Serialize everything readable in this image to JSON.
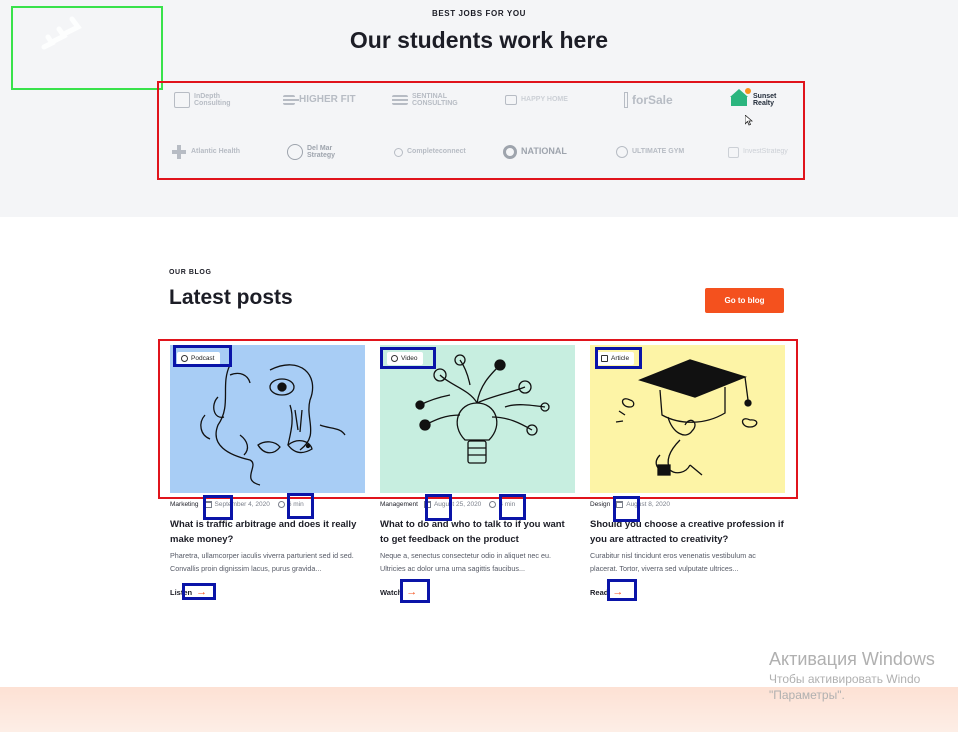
{
  "partners": {
    "eyebrow": "BEST JOBS FOR YOU",
    "title": "Our students work here",
    "logos": [
      {
        "name": "InDepth Consulting",
        "icon": "square-frame-icon"
      },
      {
        "name": "HIGHER FIT",
        "icon": "lines-icon"
      },
      {
        "name": "SENTINAL CONSULTING",
        "icon": "lines-icon"
      },
      {
        "name": "HAPPY HOME",
        "icon": "house-icon"
      },
      {
        "name": "forSale",
        "icon": "sign-icon"
      },
      {
        "name": "Sunset Realty",
        "icon": "house-sun-icon"
      },
      {
        "name": "Atlantic Health",
        "icon": "cross-icon"
      },
      {
        "name": "Del Mar Strategy",
        "icon": "swirl-icon"
      },
      {
        "name": "Completeconnect",
        "icon": "circle-icon"
      },
      {
        "name": "NATIONAL",
        "icon": "badge-icon"
      },
      {
        "name": "ULTIMATE GYM",
        "icon": "circle-icon"
      },
      {
        "name": "InvestStrategy",
        "icon": "square-frame-icon"
      }
    ]
  },
  "blog": {
    "eyebrow": "OUR BLOG",
    "title": "Latest posts",
    "button": "Go to blog",
    "posts": [
      {
        "tag": "Podcast",
        "tag_icon": "microphone-icon",
        "category": "Marketing",
        "date": "September 4, 2020",
        "duration": "6 min",
        "title": "What is traffic arbitrage and does it really make money?",
        "excerpt": "Pharetra, ullamcorper iaculis viverra parturient sed id sed. Convallis proin dignissim lacus, purus gravida...",
        "action": "Listen",
        "image_bg": "#a8cdf5"
      },
      {
        "tag": "Video",
        "tag_icon": "play-icon",
        "category": "Management",
        "date": "August 25, 2020",
        "duration": "4 min",
        "title": "What to do and who to talk to if you want to get feedback on the product",
        "excerpt": "Neque a, senectus consectetur odio in aliquet nec eu. Ultricies ac dolor urna urna sagittis faucibus...",
        "action": "Watch",
        "image_bg": "#c7eee0"
      },
      {
        "tag": "Article",
        "tag_icon": "document-icon",
        "category": "Design",
        "date": "August 8, 2020",
        "duration": "",
        "title": "Should you choose a creative profession if you are attracted to creativity?",
        "excerpt": "Curabitur nisl tincidunt eros venenatis vestibulum ac placerat. Tortor, viverra sed vulputate ultrices...",
        "action": "Read",
        "image_bg": "#fdf4a6"
      }
    ]
  },
  "watermark": {
    "title": "Активация Windows",
    "line1": "Чтобы активировать Windo",
    "line2": "\"Параметры\"."
  },
  "colors": {
    "accent": "#f4511e",
    "heading": "#1c1d26",
    "muted": "#7a7f8a"
  }
}
